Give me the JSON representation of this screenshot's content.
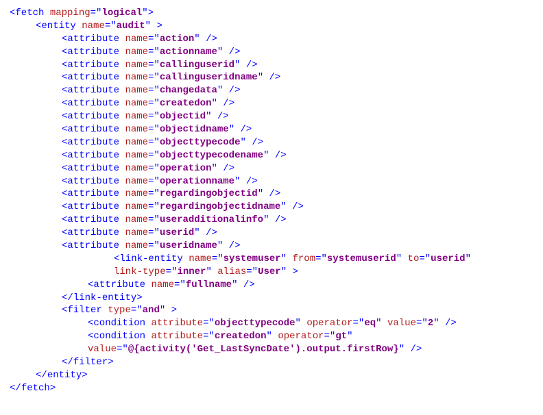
{
  "fetch": {
    "mapping": "logical"
  },
  "entity": {
    "name": "audit"
  },
  "attributes": [
    "action",
    "actionname",
    "callinguserid",
    "callinguseridname",
    "changedata",
    "createdon",
    "objectid",
    "objectidname",
    "objecttypecode",
    "objecttypecodename",
    "operation",
    "operationname",
    "regardingobjectid",
    "regardingobjectidname",
    "useradditionalinfo",
    "userid",
    "useridname"
  ],
  "linkEntity": {
    "name": "systemuser",
    "from": "systemuserid",
    "to": "userid",
    "linkType": "inner",
    "alias": "User",
    "attr": "fullname"
  },
  "filter": {
    "type": "and",
    "c1": {
      "attr": "objecttypecode",
      "op": "eq",
      "val": "2"
    },
    "c2": {
      "attr": "createdon",
      "op": "gt",
      "val": "@{activity('Get_LastSyncDate').output.firstRow}"
    }
  },
  "kw": {
    "fetch": "fetch",
    "entity": "entity",
    "attribute": "attribute",
    "linkEntity": "link-entity",
    "filter": "filter",
    "condition": "condition",
    "mapping": "mapping",
    "name": "name",
    "from": "from",
    "to": "to",
    "linkType": "link-type",
    "alias": "alias",
    "type": "type",
    "attributeAttr": "attribute",
    "operator": "operator",
    "value": "value"
  }
}
